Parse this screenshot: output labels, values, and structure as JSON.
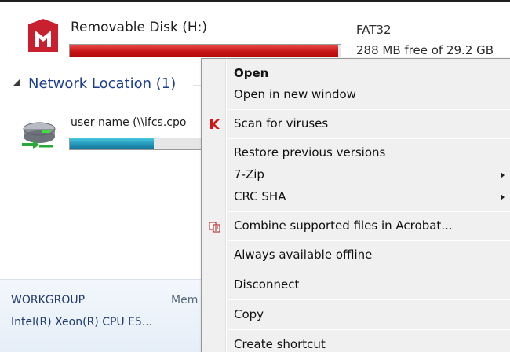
{
  "drive": {
    "name": "Removable Disk (H:)",
    "filesystem": "FAT32",
    "free_text": "288 MB free of 29.2 GB",
    "used_fraction": 0.99,
    "bar_color": "#c61313"
  },
  "network_group": {
    "title": "Network Location (1)"
  },
  "network_item": {
    "name": "user name (\\\\ifcs.cpo",
    "used_fraction": 0.63,
    "bar_color": "#1f8fb2"
  },
  "details": {
    "workgroup": "WORKGROUP",
    "member": "Mem",
    "cpu": "Intel(R) Xeon(R) CPU E5..."
  },
  "context_menu": {
    "open": "Open",
    "open_new_window": "Open in new window",
    "scan_viruses": "Scan for viruses",
    "restore_versions": "Restore previous versions",
    "seven_zip": "7-Zip",
    "crc_sha": "CRC SHA",
    "combine_acrobat": "Combine supported files in Acrobat...",
    "available_offline": "Always available offline",
    "disconnect": "Disconnect",
    "copy": "Copy",
    "create_shortcut": "Create shortcut"
  },
  "colors": {
    "group_title": "#1e3f8f",
    "menu_background": "#f0f0f0",
    "mcafee_red": "#c8202e"
  }
}
